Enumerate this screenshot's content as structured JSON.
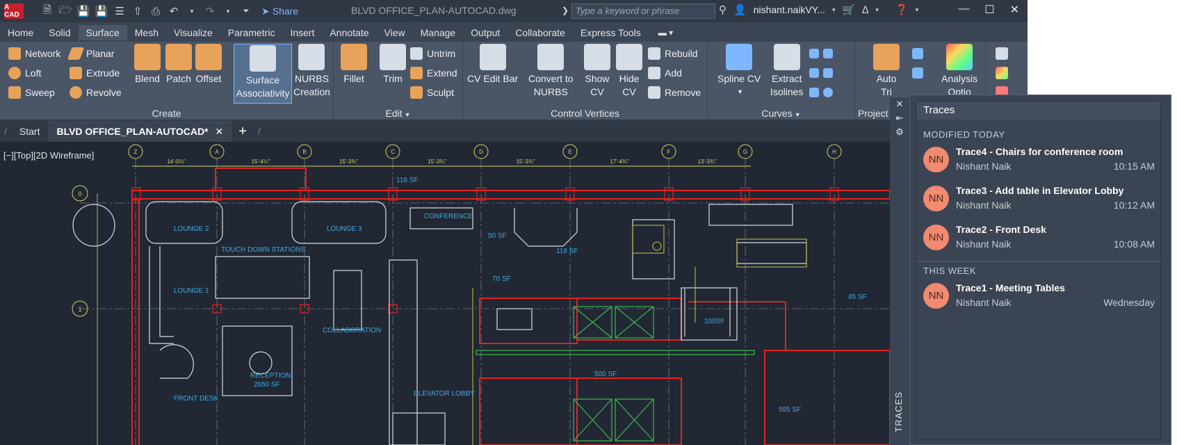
{
  "app": {
    "logo_text": "A CAD",
    "doc_title": "BLVD OFFICE_PLAN-AUTOCAD.dwg",
    "search_placeholder": "Type a keyword or phrase",
    "user": "nishant.naikVY...",
    "share_label": "Share"
  },
  "menu_tabs": [
    "Home",
    "Solid",
    "Surface",
    "Mesh",
    "Visualize",
    "Parametric",
    "Insert",
    "Annotate",
    "View",
    "Manage",
    "Output",
    "Collaborate",
    "Express Tools"
  ],
  "active_tab": "Surface",
  "ribbon": {
    "create": {
      "title": "Create",
      "small": [
        "Network",
        "Planar",
        "Loft",
        "Extrude",
        "Sweep",
        "Revolve"
      ],
      "big": [
        "Blend",
        "Patch",
        "Offset"
      ],
      "surface_associativity": [
        "Surface",
        "Associativity"
      ],
      "nurbs": [
        "NURBS",
        "Creation"
      ]
    },
    "edit": {
      "title": "Edit",
      "big": [
        "Fillet",
        "Trim"
      ],
      "small": [
        "Untrim",
        "Extend",
        "Sculpt"
      ]
    },
    "control_vertices": {
      "title": "Control Vertices",
      "cv_edit_bar": "CV Edit Bar",
      "convert": [
        "Convert to",
        "NURBS"
      ],
      "show": [
        "Show",
        "CV"
      ],
      "hide": [
        "Hide",
        "CV"
      ],
      "small": [
        "Rebuild",
        "Add",
        "Remove"
      ]
    },
    "curves": {
      "title": "Curves",
      "spline": "Spline CV",
      "extract": [
        "Extract",
        "Isolines"
      ]
    },
    "project": {
      "title": "Project",
      "auto": [
        "Auto",
        "Tri"
      ]
    },
    "analysis": {
      "label": [
        "Analysis",
        "Optio"
      ]
    }
  },
  "doc_tabs": {
    "start": "Start",
    "active": "BLVD OFFICE_PLAN-AUTOCAD*"
  },
  "viewport_label": "[−][Top][2D Wireframe]",
  "drawing": {
    "grid_bubbles": [
      "Z",
      "A",
      "B",
      "C",
      "D",
      "E",
      "F",
      "G",
      "H"
    ],
    "row_bubbles": [
      "0",
      "1"
    ],
    "dimensions": [
      "14'-0½\"",
      "15'-4¼\"",
      "15'-3¾\"",
      "15'-3¾\"",
      "15'-3¾\"",
      "17'-4¾\"",
      "13'-3¾\""
    ],
    "labels": {
      "area_118a": "118 SF",
      "lounge2": "LOUNGE 2",
      "lounge3": "LOUNGE 3",
      "conference": "CONFERENCE",
      "sf50": "50 SF",
      "sf118b": "118 SF",
      "touchdown": "TOUCH DOWN STATIONS",
      "lounge1": "LOUNGE 1",
      "sf70": "70 SF",
      "collab": "COLLABORATION",
      "sf100": "100SF",
      "sf45": "45 SF",
      "reception": "RECEPTION",
      "sf2650": "2650 SF",
      "sf500": "500 SF",
      "elevator_lobby": "ELEVATOR LOBBY",
      "front_desk": "FRONT DESK",
      "sf595": "595 SF"
    }
  },
  "palette_strip_label": "TRACES",
  "traces": {
    "title": "Traces",
    "sections": [
      {
        "label": "MODIFIED TODAY",
        "items": [
          {
            "initials": "NN",
            "title": "Trace4 - Chairs for conference room",
            "author": "Nishant Naik",
            "time": "10:15 AM"
          },
          {
            "initials": "NN",
            "title": "Trace3 - Add table in Elevator Lobby",
            "author": "Nishant Naik",
            "time": "10:12 AM"
          },
          {
            "initials": "NN",
            "title": "Trace2 - Front Desk",
            "author": "Nishant Naik",
            "time": "10:08 AM"
          }
        ]
      },
      {
        "label": "THIS WEEK",
        "items": [
          {
            "initials": "NN",
            "title": "Trace1 - Meeting Tables",
            "author": "Nishant Naik",
            "time": "Wednesday"
          }
        ]
      }
    ]
  },
  "colors": {
    "accent": "#7fb7ff",
    "avatar": "#f28a70",
    "walls_red": "#e02424",
    "linework_white": "#d9dde3",
    "annotation_cyan": "#3fa9e0",
    "elevator_green": "#3fb94f"
  }
}
